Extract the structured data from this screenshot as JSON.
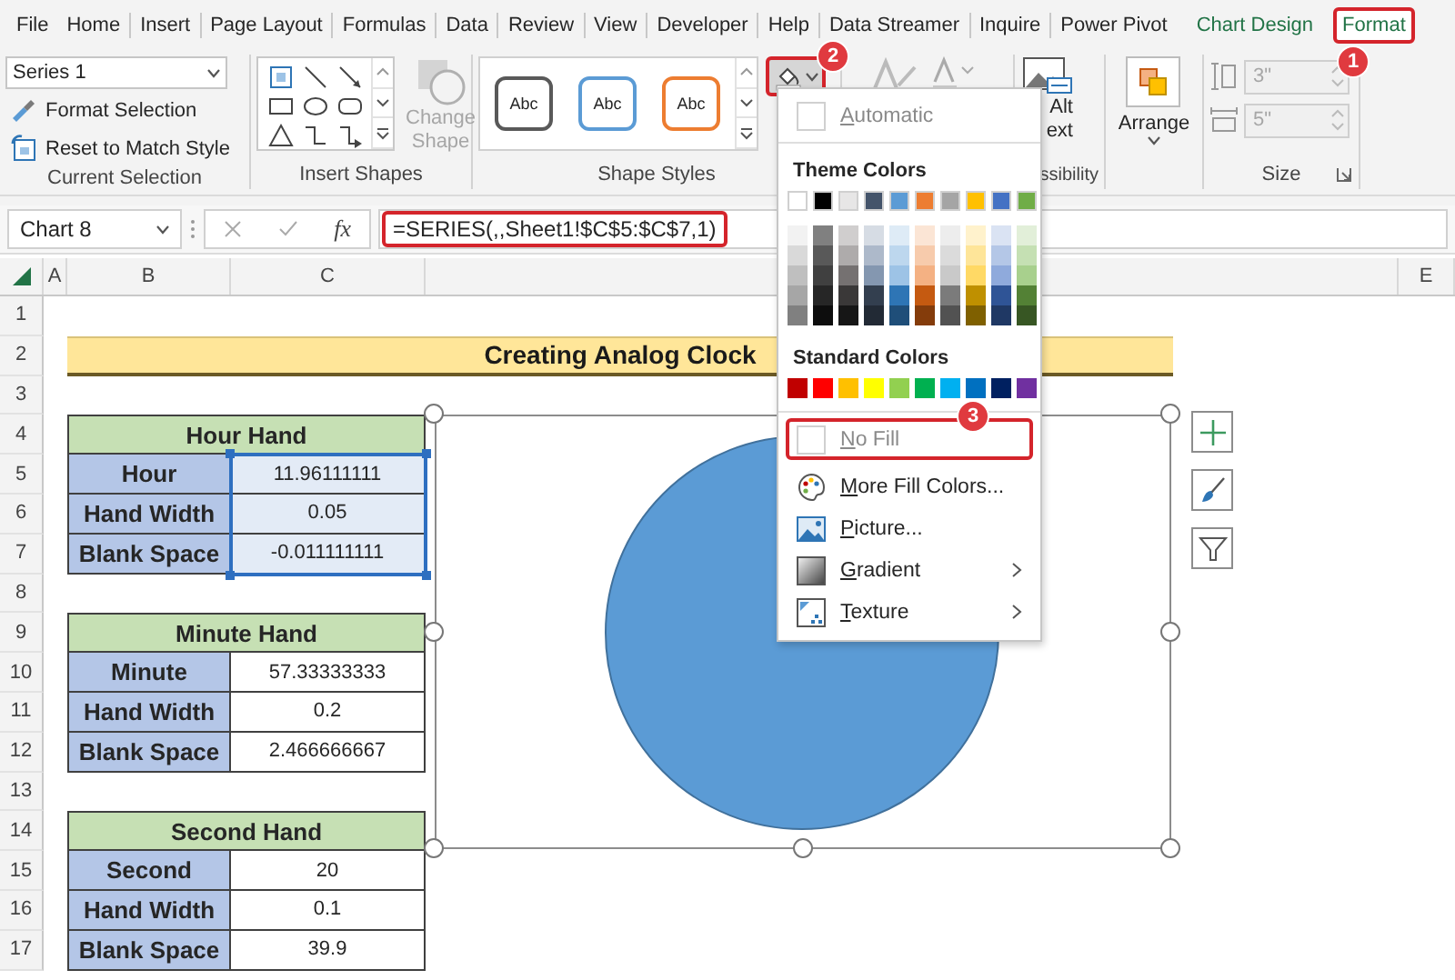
{
  "menu_tabs": [
    {
      "label": "File",
      "selected": false,
      "contextual": false
    },
    {
      "label": "Home",
      "selected": false,
      "contextual": false
    },
    {
      "label": "Insert",
      "selected": false,
      "contextual": false
    },
    {
      "label": "Page Layout",
      "selected": false,
      "contextual": false
    },
    {
      "label": "Formulas",
      "selected": false,
      "contextual": false
    },
    {
      "label": "Data",
      "selected": false,
      "contextual": false
    },
    {
      "label": "Review",
      "selected": false,
      "contextual": false
    },
    {
      "label": "View",
      "selected": false,
      "contextual": false
    },
    {
      "label": "Developer",
      "selected": false,
      "contextual": false
    },
    {
      "label": "Help",
      "selected": false,
      "contextual": false
    },
    {
      "label": "Data Streamer",
      "selected": false,
      "contextual": false
    },
    {
      "label": "Inquire",
      "selected": false,
      "contextual": false
    },
    {
      "label": "Power Pivot",
      "selected": false,
      "contextual": false
    },
    {
      "label": "Chart Design",
      "selected": false,
      "contextual": true
    },
    {
      "label": "Format",
      "selected": true,
      "contextual": true,
      "annotation": "1"
    }
  ],
  "ribbon": {
    "current_selection": {
      "dropdown": "Series 1",
      "buttons": [
        {
          "label": "Format Selection",
          "kind": "format"
        },
        {
          "label": "Reset to Match Style",
          "kind": "reset"
        }
      ],
      "group_label": "Current Selection"
    },
    "insert_shapes": {
      "change_shape": [
        "Change",
        "Shape"
      ],
      "change_shape_disabled": true,
      "group_label": "Insert Shapes"
    },
    "shape_styles": {
      "presets": [
        {
          "label": "Abc",
          "color": "#595959"
        },
        {
          "label": "Abc",
          "color": "#5b9bd5"
        },
        {
          "label": "Abc",
          "color": "#ed7d31"
        }
      ],
      "group_label": "Shape Styles",
      "fill_button": {
        "expanded": true,
        "annotation": "2"
      }
    },
    "accessibility": {
      "button_lines": [
        "Alt",
        "ext"
      ],
      "group_label": "ssibility"
    },
    "arrange": {
      "label": "Arrange"
    },
    "size": {
      "fields": [
        {
          "kind": "height",
          "value": "3\""
        },
        {
          "kind": "width",
          "value": "5\""
        }
      ],
      "disabled": true,
      "group_label": "Size"
    }
  },
  "formula_bar": {
    "name_box": "Chart 8",
    "fx": "fx",
    "formula": "=SERIES(,,Sheet1!$C$5:$C$7,1)",
    "highlighted": true
  },
  "fill_menu": {
    "automatic": {
      "label": "Automatic",
      "disabled": true
    },
    "theme_title": "Theme Colors",
    "theme_colors": [
      {
        "color": "#ffffff",
        "shades": [
          {
            "color": "#f2f2f2"
          },
          {
            "color": "#d9d9d9"
          },
          {
            "color": "#bfbfbf"
          },
          {
            "color": "#a6a6a6"
          },
          {
            "color": "#808080"
          }
        ]
      },
      {
        "color": "#000000",
        "shades": [
          {
            "color": "#808080"
          },
          {
            "color": "#595959"
          },
          {
            "color": "#404040"
          },
          {
            "color": "#262626"
          },
          {
            "color": "#0d0d0d"
          }
        ]
      },
      {
        "color": "#e7e6e6",
        "shades": [
          {
            "color": "#d0cece"
          },
          {
            "color": "#aeabab"
          },
          {
            "color": "#757171"
          },
          {
            "color": "#3a3838"
          },
          {
            "color": "#161616"
          }
        ]
      },
      {
        "color": "#44546a",
        "shades": [
          {
            "color": "#d6dce4"
          },
          {
            "color": "#adb9ca"
          },
          {
            "color": "#8497b0"
          },
          {
            "color": "#333f4f"
          },
          {
            "color": "#222a35"
          }
        ]
      },
      {
        "color": "#5b9bd5",
        "shades": [
          {
            "color": "#deebf6"
          },
          {
            "color": "#bdd7ee"
          },
          {
            "color": "#9dc3e6"
          },
          {
            "color": "#2e75b5"
          },
          {
            "color": "#1f4e79"
          }
        ]
      },
      {
        "color": "#ed7d31",
        "shades": [
          {
            "color": "#fbe5d5"
          },
          {
            "color": "#f7cbac"
          },
          {
            "color": "#f4b183"
          },
          {
            "color": "#c55a11"
          },
          {
            "color": "#843c0b"
          }
        ]
      },
      {
        "color": "#a5a5a5",
        "shades": [
          {
            "color": "#ededed"
          },
          {
            "color": "#dbdbdb"
          },
          {
            "color": "#c9c9c9"
          },
          {
            "color": "#7b7b7b"
          },
          {
            "color": "#525252"
          }
        ]
      },
      {
        "color": "#ffc000",
        "shades": [
          {
            "color": "#fff2cc"
          },
          {
            "color": "#fee599"
          },
          {
            "color": "#ffd965"
          },
          {
            "color": "#bf9000"
          },
          {
            "color": "#7f6000"
          }
        ]
      },
      {
        "color": "#4472c4",
        "shades": [
          {
            "color": "#dae3f3"
          },
          {
            "color": "#b4c7e7"
          },
          {
            "color": "#8faadc"
          },
          {
            "color": "#2f5496"
          },
          {
            "color": "#1f3864"
          }
        ]
      },
      {
        "color": "#70ad47",
        "shades": [
          {
            "color": "#e2efd9"
          },
          {
            "color": "#c5e0b3"
          },
          {
            "color": "#a8d08d"
          },
          {
            "color": "#538135"
          },
          {
            "color": "#375623"
          }
        ]
      }
    ],
    "standard_title": "Standard Colors",
    "standard_colors": [
      {
        "color": "#c00000"
      },
      {
        "color": "#ff0000"
      },
      {
        "color": "#ffc000"
      },
      {
        "color": "#ffff00"
      },
      {
        "color": "#92d050"
      },
      {
        "color": "#00b050"
      },
      {
        "color": "#00b0f0"
      },
      {
        "color": "#0070c0"
      },
      {
        "color": "#002060"
      },
      {
        "color": "#7030a0"
      }
    ],
    "items": [
      {
        "label": "No Fill",
        "kind": "swatch",
        "disabled": true,
        "submenu": false,
        "annotation": "3"
      },
      {
        "label": "More Fill Colors...",
        "kind": "palette",
        "disabled": false,
        "submenu": false
      },
      {
        "label": "Picture...",
        "kind": "picture",
        "disabled": false,
        "submenu": false
      },
      {
        "label": "Gradient",
        "kind": "gradient",
        "disabled": false,
        "submenu": true
      },
      {
        "label": "Texture",
        "kind": "texture",
        "disabled": false,
        "submenu": true
      }
    ]
  },
  "sheet": {
    "columns": [
      "A",
      "B",
      "C",
      "E"
    ],
    "rows": [
      "1",
      "2",
      "3",
      "4",
      "5",
      "6",
      "7",
      "8",
      "9",
      "10",
      "11",
      "12",
      "13",
      "14",
      "15",
      "16",
      "17"
    ],
    "title": "Creating Analog Clock",
    "tables": [
      {
        "title": "Hour Hand",
        "range_selected": true,
        "rows": [
          {
            "label": "Hour",
            "value": "11.96111111"
          },
          {
            "label": "Hand Width",
            "value": "0.05"
          },
          {
            "label": "Blank Space",
            "value": "-0.011111111"
          }
        ]
      },
      {
        "title": "Minute Hand",
        "range_selected": false,
        "rows": [
          {
            "label": "Minute",
            "value": "57.33333333"
          },
          {
            "label": "Hand Width",
            "value": "0.2"
          },
          {
            "label": "Blank Space",
            "value": "2.466666667"
          }
        ]
      },
      {
        "title": "Second Hand",
        "range_selected": false,
        "rows": [
          {
            "label": "Second",
            "value": "20"
          },
          {
            "label": "Hand Width",
            "value": "0.1"
          },
          {
            "label": "Blank Space",
            "value": "39.9"
          }
        ]
      }
    ]
  },
  "chart": {
    "selected": true
  }
}
